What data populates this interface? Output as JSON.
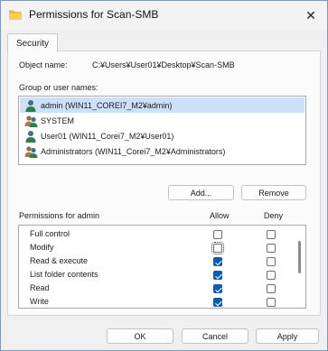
{
  "window": {
    "title": "Permissions for Scan-SMB",
    "close_glyph": "✕",
    "icon": "folder-icon"
  },
  "tabs": [
    {
      "label": "Security",
      "selected": true
    }
  ],
  "object": {
    "label": "Object name:",
    "value": "C:¥Users¥User01¥Desktop¥Scan-SMB"
  },
  "groups": {
    "label": "Group or user names:",
    "items": [
      {
        "name": "admin (WIN11_COREI7_M2¥admin)",
        "icon": "user-icon",
        "selected": true
      },
      {
        "name": "SYSTEM",
        "icon": "group-icon",
        "selected": false
      },
      {
        "name": "User01 (WIN11_Corei7_M2¥User01)",
        "icon": "user-icon",
        "selected": false
      },
      {
        "name": "Administrators (WIN11_Corei7_M2¥Administrators)",
        "icon": "group-icon",
        "selected": false
      }
    ]
  },
  "buttons": {
    "add": "Add...",
    "remove": "Remove",
    "ok": "OK",
    "cancel": "Cancel",
    "apply": "Apply"
  },
  "permissions": {
    "label": "Permissions for admin",
    "allow_header": "Allow",
    "deny_header": "Deny",
    "rows": [
      {
        "name": "Full control",
        "allow": false,
        "deny": false
      },
      {
        "name": "Modify",
        "allow": false,
        "deny": false
      },
      {
        "name": "Read & execute",
        "allow": true,
        "deny": false
      },
      {
        "name": "List folder contents",
        "allow": true,
        "deny": false
      },
      {
        "name": "Read",
        "allow": true,
        "deny": false
      },
      {
        "name": "Write",
        "allow": true,
        "deny": false
      }
    ]
  },
  "colors": {
    "accent": "#0b5cad",
    "selection": "#cce1f7"
  }
}
